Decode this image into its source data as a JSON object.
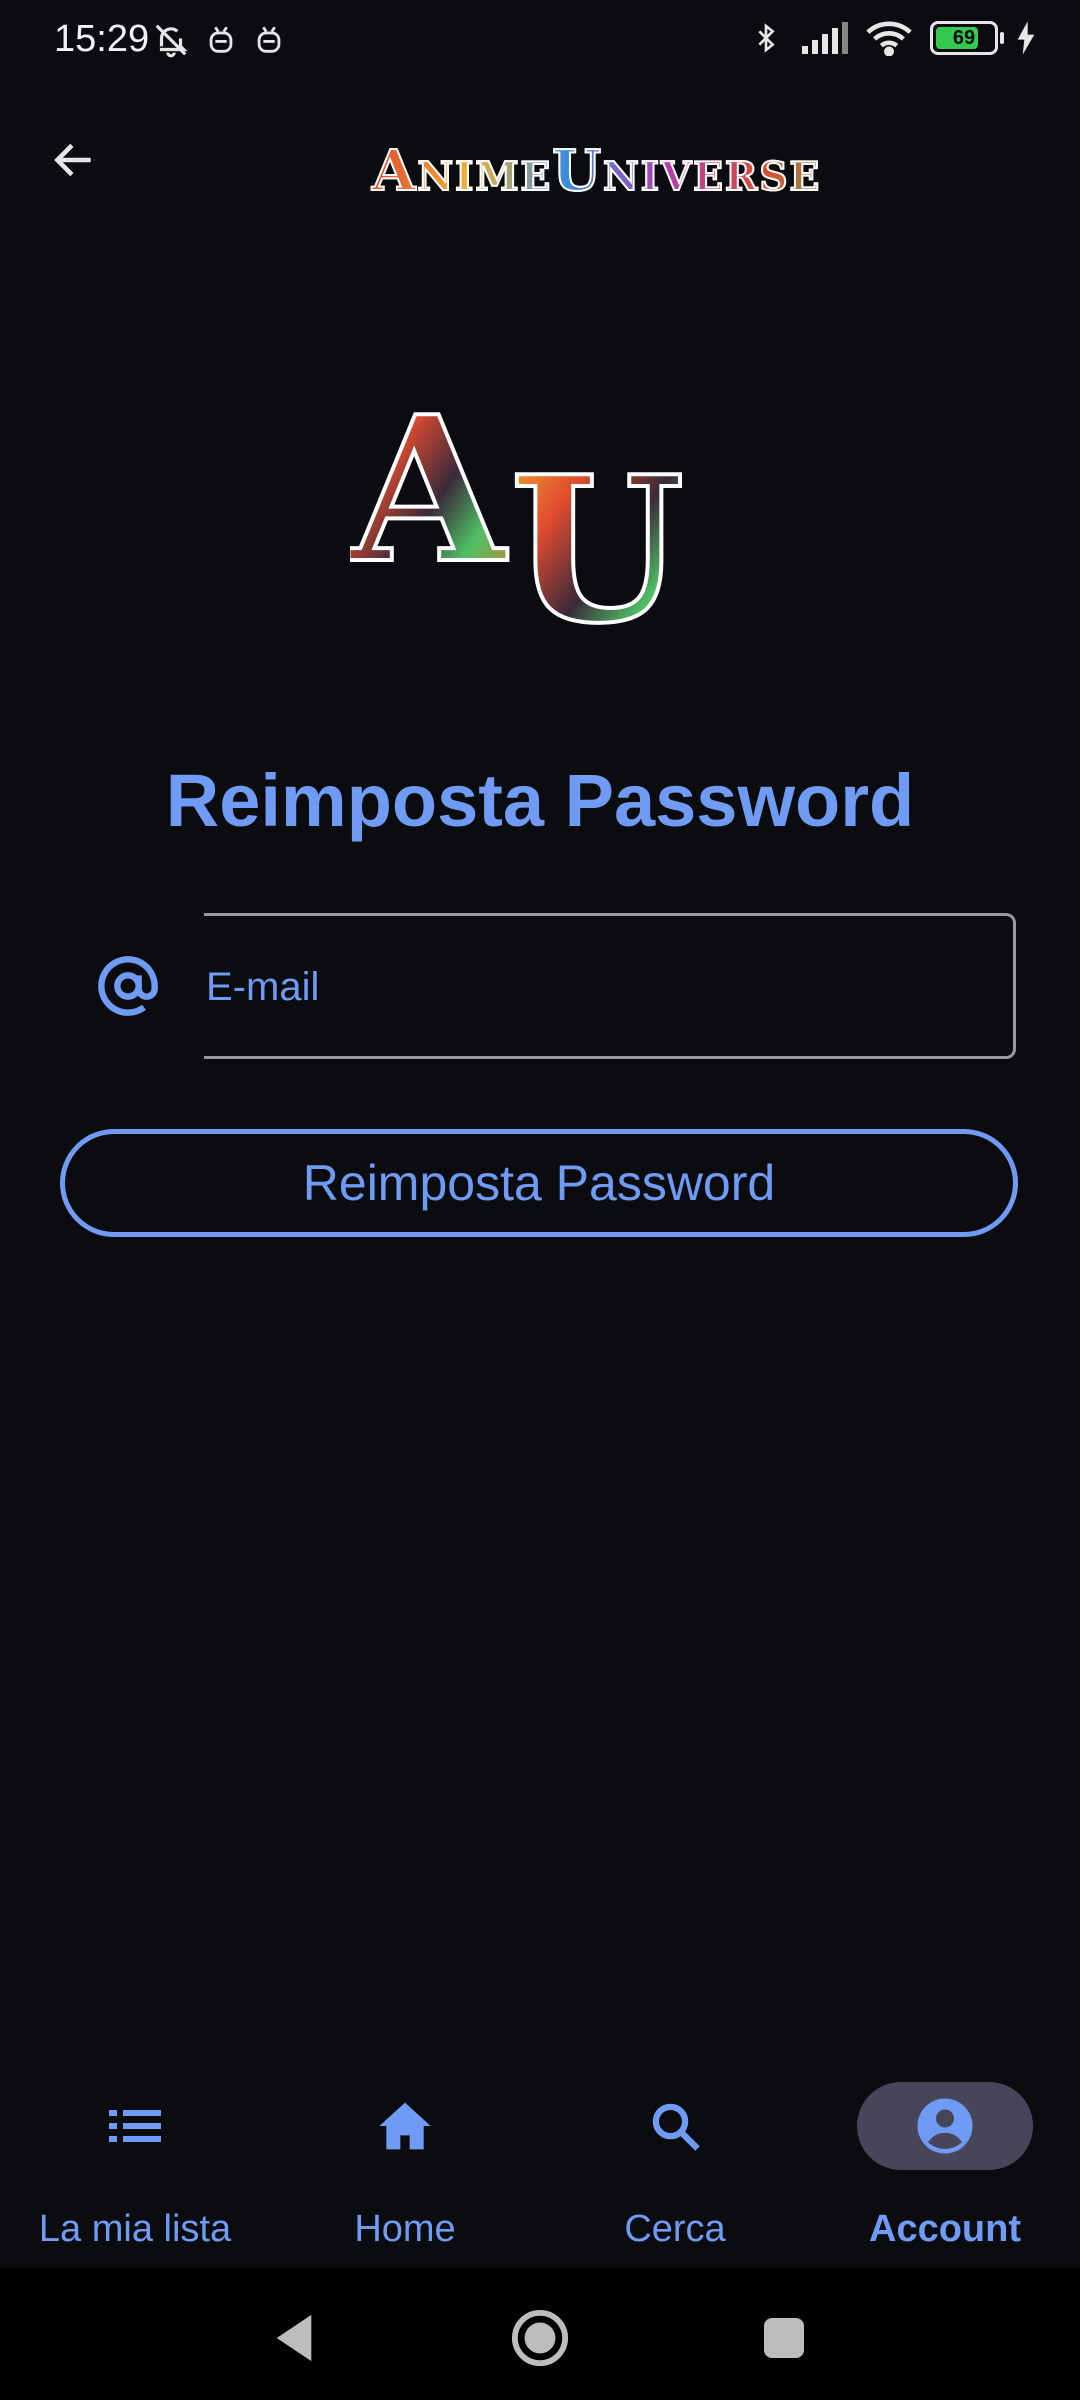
{
  "status_bar": {
    "time": "15:29",
    "battery_level": "69",
    "icons_left": [
      "bell-off-icon",
      "robot-icon",
      "robot-icon"
    ],
    "icons_right": [
      "bluetooth-icon",
      "signal-icon",
      "wifi-icon",
      "battery-icon",
      "charging-icon"
    ]
  },
  "app_bar": {
    "back_icon": "arrow-left-icon",
    "brand_word1": "Anime",
    "brand_word2": "Universe"
  },
  "logo": {
    "letters": "AU"
  },
  "page": {
    "title": "Reimposta Password"
  },
  "form": {
    "email_icon": "at-icon",
    "email_placeholder": "E-mail",
    "email_value": "",
    "submit_label": "Reimposta Password"
  },
  "bottom_nav": {
    "items": [
      {
        "label": "La mia lista",
        "icon": "list-icon",
        "active": false
      },
      {
        "label": "Home",
        "icon": "home-icon",
        "active": false
      },
      {
        "label": "Cerca",
        "icon": "search-icon",
        "active": false
      },
      {
        "label": "Account",
        "icon": "account-circle-icon",
        "active": true
      }
    ]
  },
  "colors": {
    "background": "#0b0c10",
    "accent": "#6f9bf4",
    "active_pill": "#47455a",
    "battery_fill": "#36c94f"
  }
}
